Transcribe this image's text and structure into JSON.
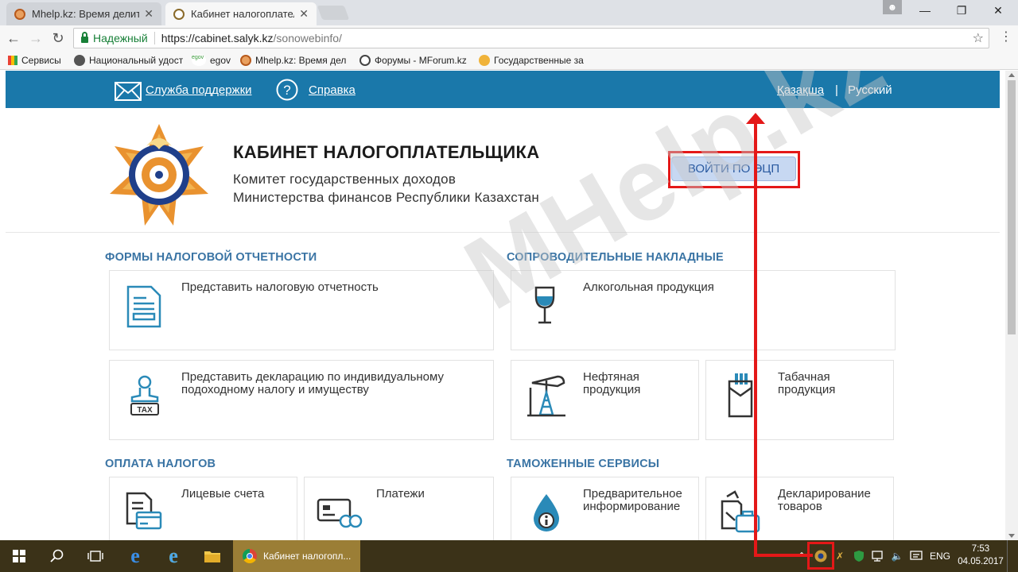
{
  "browser": {
    "tabs": [
      {
        "title": "Mhelp.kz: Время делит",
        "close": "✕"
      },
      {
        "title": "Кабинет налогоплатель",
        "close": "✕"
      }
    ],
    "window": {
      "minimize": "—",
      "maximize": "❐",
      "close": "✕"
    },
    "secure_label": "Надежный",
    "url_host": "https://cabinet.salyk.kz",
    "url_path": "/sonowebinfo/",
    "bookmarks": [
      "Сервисы",
      "Национальный удост",
      "egov",
      "Mhelp.kz: Время дел",
      "Форумы - MForum.kz",
      "Государственные за"
    ]
  },
  "site": {
    "support": "Служба поддержки",
    "help": "Справка",
    "lang_kz": "Қазақша",
    "lang_sep": "|",
    "lang_ru": "Русский",
    "title": "КАБИНЕТ НАЛОГОПЛАТЕЛЬЩИКА",
    "subtitle1": "Комитет государственных доходов",
    "subtitle2": "Министерства финансов Республики Казахстан",
    "login": "ВОЙТИ ПО ЭЦП",
    "tax_label": "TAX",
    "watermark": "MHelp.kz",
    "sections": {
      "forms": "ФОРМЫ НАЛОГОВОЙ ОТЧЕТНОСТИ",
      "waybills": "СОПРОВОДИТЕЛЬНЫЕ НАКЛАДНЫЕ",
      "payments": "ОПЛАТА НАЛОГОВ",
      "customs": "ТАМОЖЕННЫЕ СЕРВИСЫ"
    },
    "cards": {
      "submit_report": "Представить налоговую отчетность",
      "declaration_l1": "Представить декларацию по индивидуальному",
      "declaration_l2": "подоходному налогу и имуществу",
      "alcohol": "Алкогольная продукция",
      "oil_l1": "Нефтяная",
      "oil_l2": "продукция",
      "tobacco_l1": "Табачная",
      "tobacco_l2": "продукция",
      "accounts": "Лицевые счета",
      "payments": "Платежи",
      "prelim_l1": "Предварительное",
      "prelim_l2": "информирование",
      "goods_l1": "Декларирование",
      "goods_l2": "товаров"
    }
  },
  "taskbar": {
    "app_title": "Кабинет налогопл...",
    "lang": "ENG",
    "time": "7:53",
    "date": "04.05.2017"
  },
  "colors": {
    "topband": "#1a78aa",
    "section": "#3a74a4",
    "highlight": "#e41818",
    "taskbar": "#3b3218"
  }
}
